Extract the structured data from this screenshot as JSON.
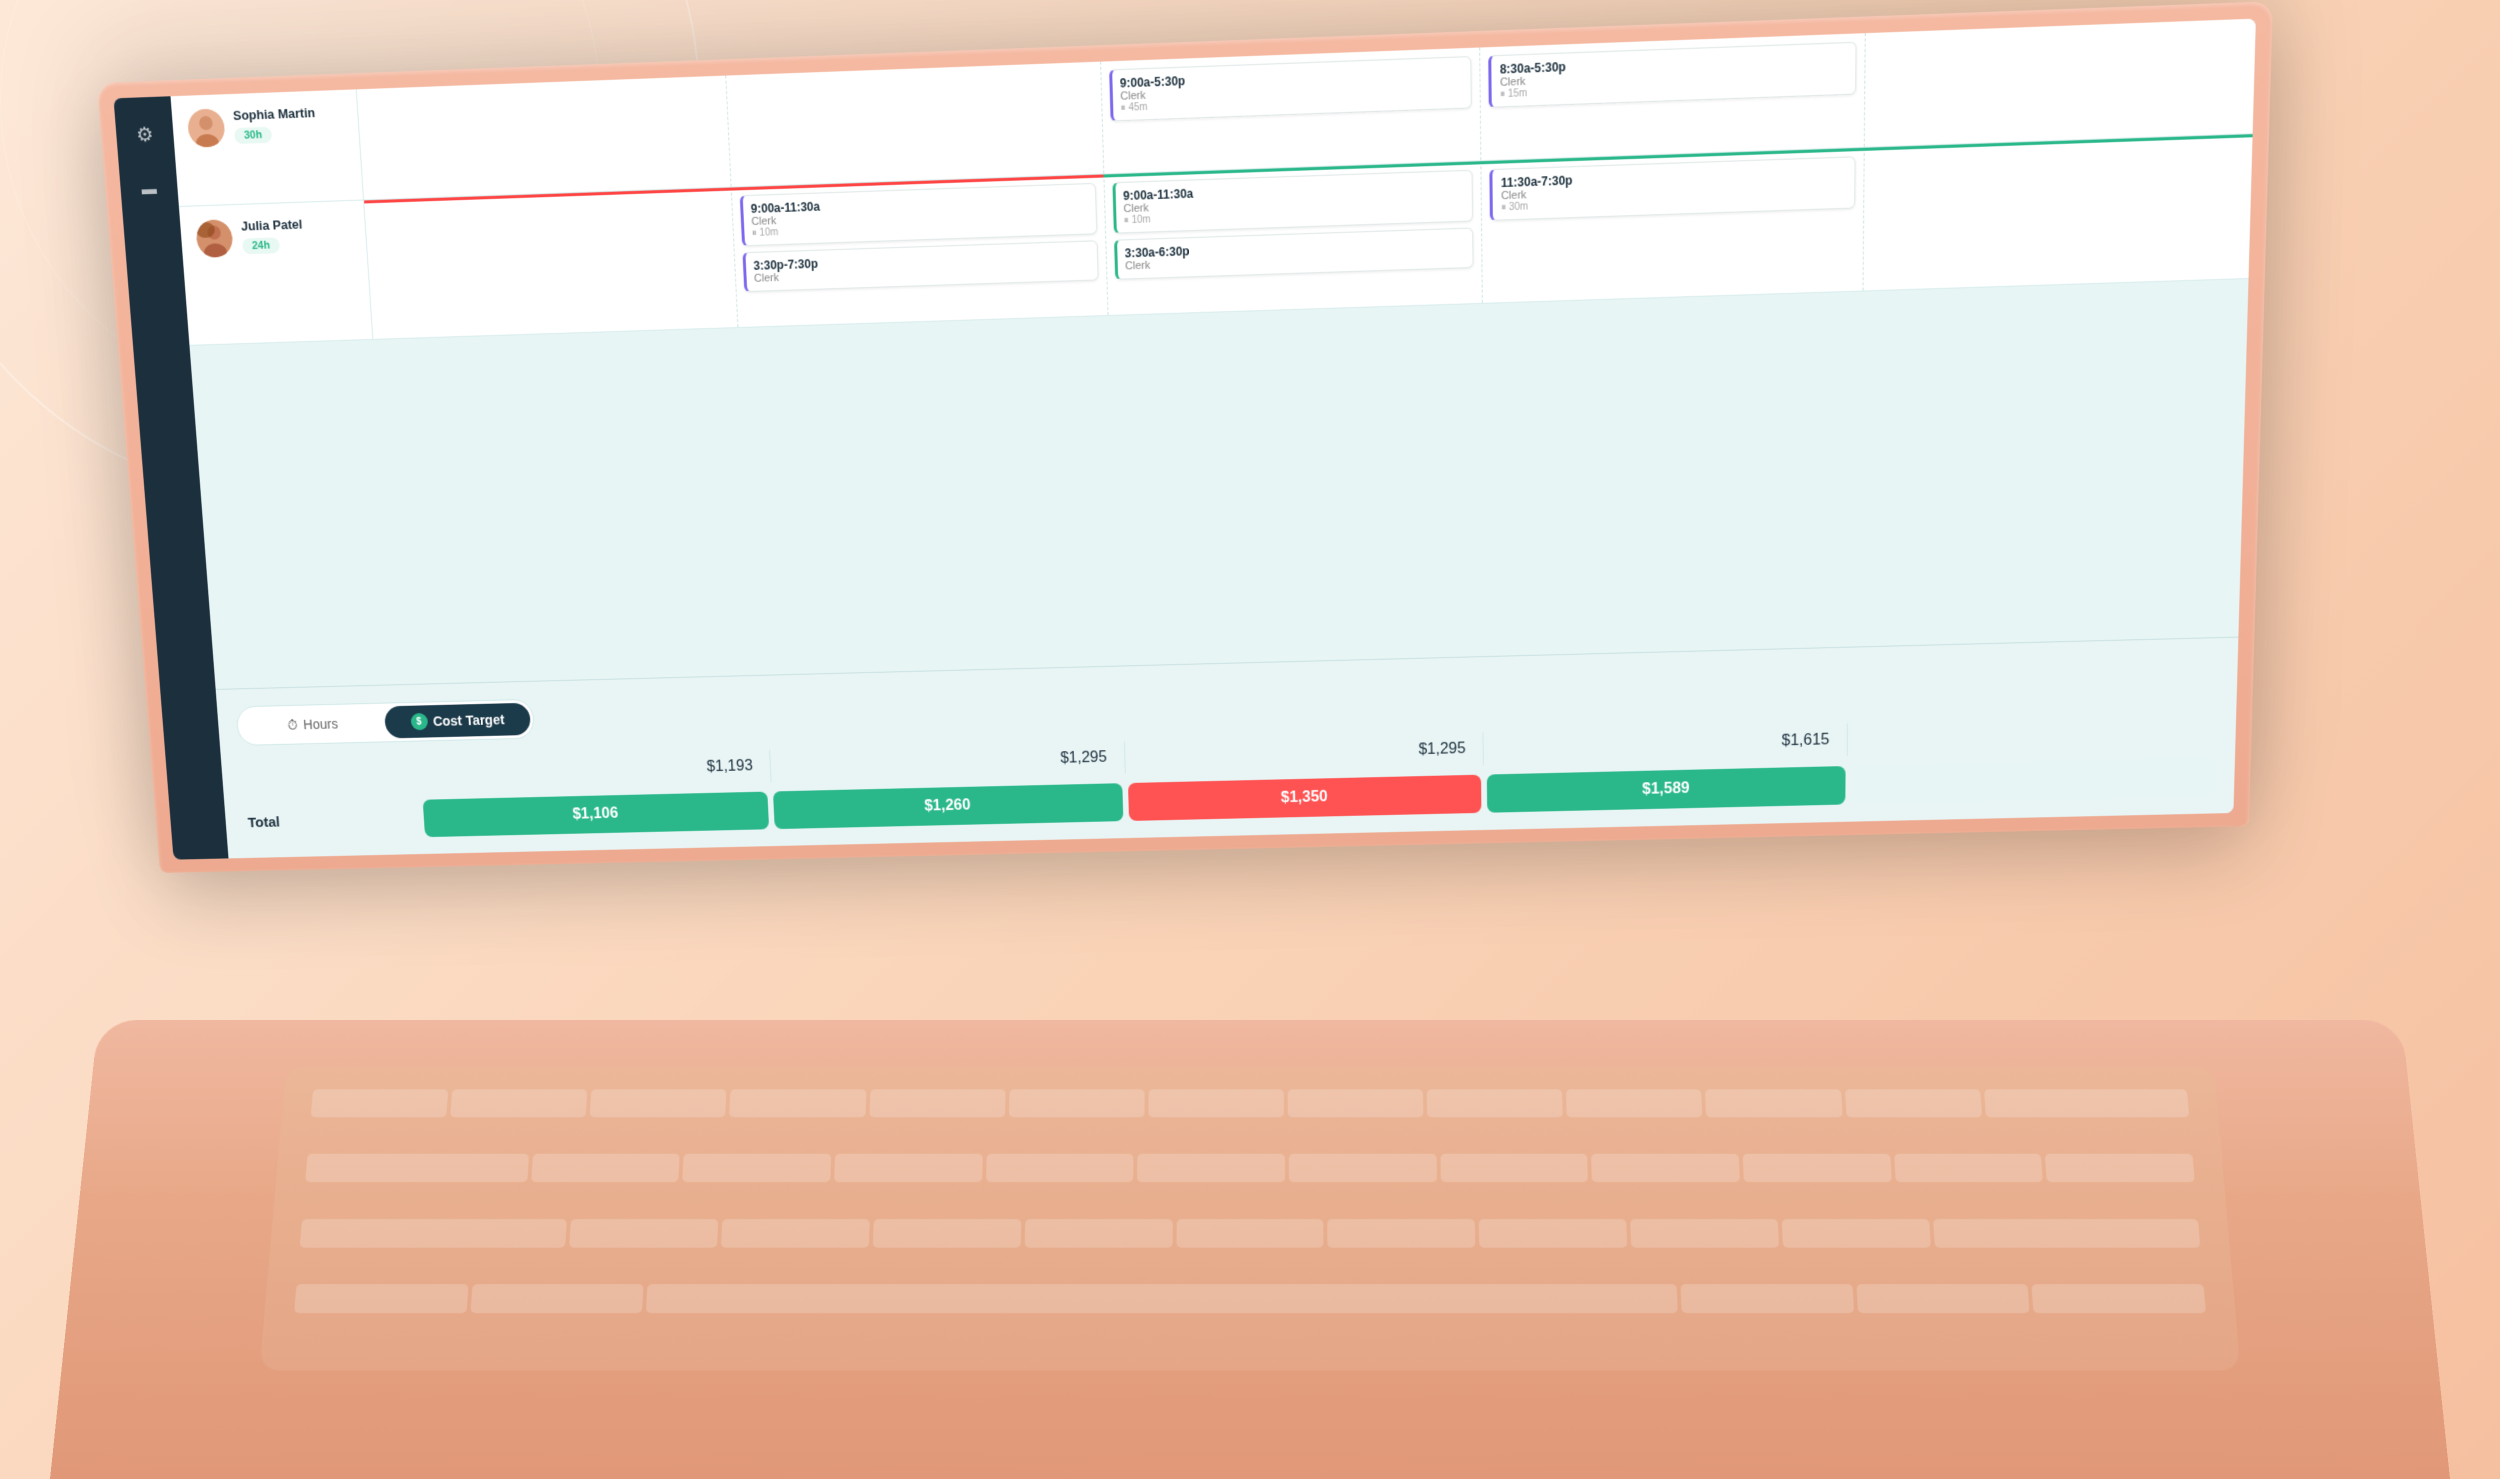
{
  "background": {
    "color": "#fde8d8"
  },
  "sidebar": {
    "icons": [
      {
        "name": "gear-icon",
        "symbol": "⚙"
      },
      {
        "name": "card-icon",
        "symbol": "▬"
      }
    ]
  },
  "employees": [
    {
      "name": "Sophia Martin",
      "hours": "30h",
      "shifts": [
        {
          "day": 3,
          "time": "9:00a-5:30p",
          "role": "Clerk",
          "break": "45m",
          "style": "blue"
        },
        {
          "day": 4,
          "time": "8:30a-5:30p",
          "role": "Clerk",
          "break": "15m",
          "style": "blue"
        }
      ]
    },
    {
      "name": "Julia Patel",
      "hours": "24h",
      "shifts": [
        {
          "day": 2,
          "time": "9:00a-11:30a",
          "role": "Clerk",
          "break": "10m",
          "style": "blue"
        },
        {
          "day": 2,
          "time": "3:30p-7:30p",
          "role": "Clerk",
          "break": "",
          "style": "blue"
        },
        {
          "day": 3,
          "time": "9:00a-11:30a",
          "role": "Clerk",
          "break": "10m",
          "style": "green"
        },
        {
          "day": 3,
          "time": "3:30a-6:30p",
          "role": "Clerk",
          "break": "",
          "style": "green"
        },
        {
          "day": 4,
          "time": "11:30a-7:30p",
          "role": "Clerk",
          "break": "30m",
          "style": "blue"
        }
      ]
    }
  ],
  "toggleBar": {
    "hours_label": "Hours",
    "hours_icon": "⏱",
    "cost_label": "Cost Target",
    "cost_icon": "$"
  },
  "costTargets": {
    "label": "",
    "days": [
      {
        "value": "$1,193"
      },
      {
        "value": "$1,295"
      },
      {
        "value": "$1,295"
      },
      {
        "value": "$1,615"
      },
      {
        "value": ""
      }
    ]
  },
  "totals": {
    "label": "Total",
    "days": [
      {
        "value": "$1,106",
        "status": "green"
      },
      {
        "value": "$1,260",
        "status": "green"
      },
      {
        "value": "$1,350",
        "status": "red"
      },
      {
        "value": "$1,589",
        "status": "green"
      },
      {
        "value": "",
        "status": "empty"
      }
    ]
  }
}
